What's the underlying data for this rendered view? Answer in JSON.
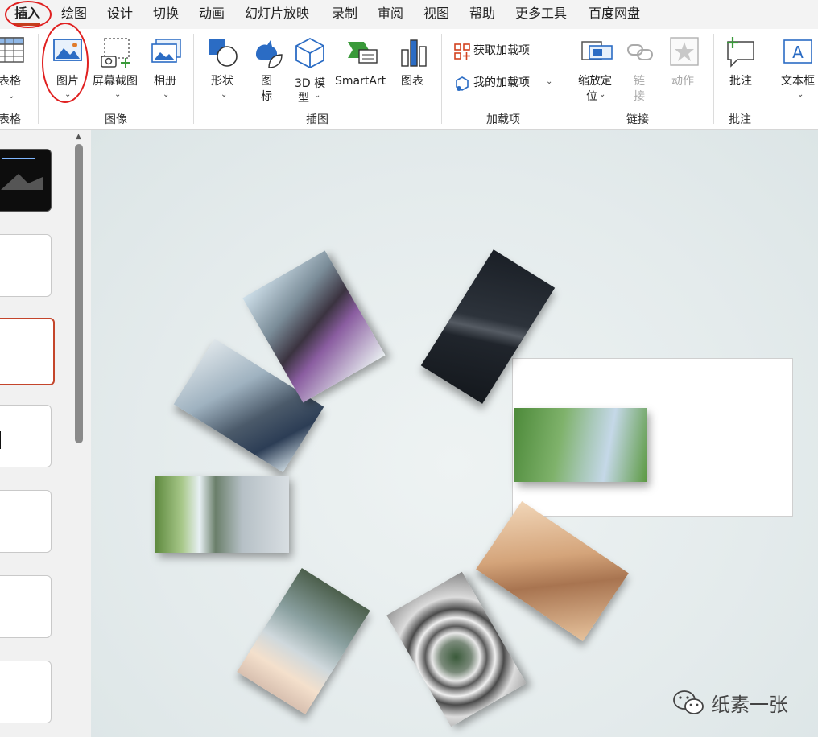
{
  "tabs": [
    "插入",
    "绘图",
    "设计",
    "切换",
    "动画",
    "幻灯片放映",
    "录制",
    "审阅",
    "视图",
    "帮助",
    "更多工具",
    "百度网盘"
  ],
  "ribbon": {
    "table": {
      "label": "表格",
      "group": "表格"
    },
    "image_group": {
      "name": "图像",
      "picture": "图片",
      "screenshot": "屏幕截图",
      "album": "相册"
    },
    "illustration_group": {
      "name": "插图",
      "shapes": "形状",
      "icons_1": "图",
      "icons_2": "标",
      "model_1": "3D 模",
      "model_2": "型",
      "smartart": "SmartArt",
      "chart": "图表"
    },
    "addins_group": {
      "name": "加载项",
      "get_addins": "获取加载项",
      "my_addins": "我的加载项"
    },
    "links_group": {
      "name": "链接",
      "zoom_1": "缩放定",
      "zoom_2": "位",
      "link_1": "链",
      "link_2": "接",
      "action": "动作"
    },
    "comments_group": {
      "name": "批注",
      "comment": "批注"
    },
    "text_group": {
      "textbox": "文本框"
    }
  },
  "slide": {
    "photos": [
      "person-with-vr-headset",
      "two-people-at-laptop",
      "dark-mountain-peak",
      "person-in-glove-on-grass",
      "stacked-wooden-blocks",
      "spiral-staircase-view",
      "whale-tail-over-water",
      "waterfall-cliff"
    ]
  },
  "watermark": {
    "text": "纸素一张"
  },
  "colors": {
    "accent": "#c43e1c",
    "annotation": "#e02020",
    "icon_blue": "#2b6cc4",
    "icon_green": "#3a9a3a"
  }
}
